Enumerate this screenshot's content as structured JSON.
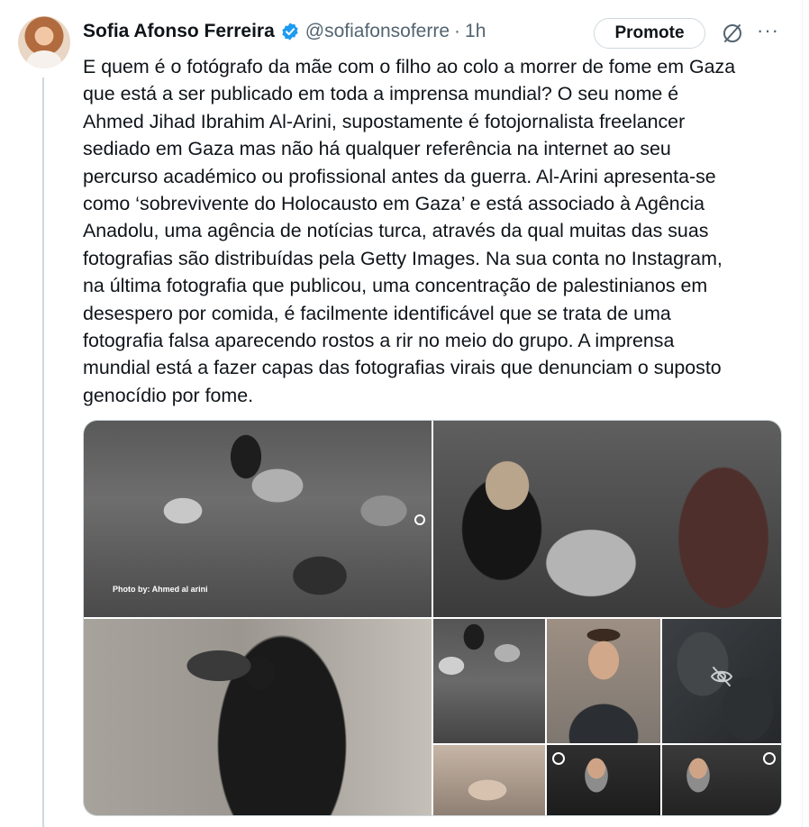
{
  "author": {
    "name": "Sofia Afonso Ferreira",
    "handle": "@sofiafonsoferre",
    "separator": "·",
    "time": "1h",
    "verified": true
  },
  "actions": {
    "promote_label": "Promote",
    "grok_icon": "grok-slash-icon",
    "more_icon": "more-horizontal-icon",
    "more_label": "···"
  },
  "tweet": {
    "lines": [
      "E quem é o fotógrafo da mãe com o filho ao colo a morrer de fome em Gaza",
      "que está a ser publicado em toda a imprensa mundial? O seu nome é",
      "Ahmed Jihad Ibrahim Al-Arini, supostamente é fotojornalista freelancer",
      "sediado em Gaza mas não há qualquer referência na internet ao seu",
      "percurso académico ou profissional antes da guerra. Al-Arini apresenta-se",
      "como ‘sobrevivente do Holocausto em Gaza’ e está associado à Agência",
      "Anadolu, uma agência de notícias turca, através da qual muitas das suas",
      "fotografias são distribuídas pela Getty Images. Na sua conta no Instagram,",
      "na última fotografia que publicou, uma concentração de palestinianos em",
      "desespero por comida, é facilmente identificável que se trata de uma",
      "fotografia falsa aparecendo rostos a rir no meio do grupo. A imprensa",
      "mundial está a fazer capas das fotografias virais que denunciam o suposto",
      "genocídio por fome."
    ]
  },
  "media": {
    "photo_credit": "Photo by: Ahmed al arini",
    "hidden_icon": "eye-slash-icon",
    "colors": {
      "border": "#cfd9de",
      "verified": "#1d9bf0"
    }
  }
}
